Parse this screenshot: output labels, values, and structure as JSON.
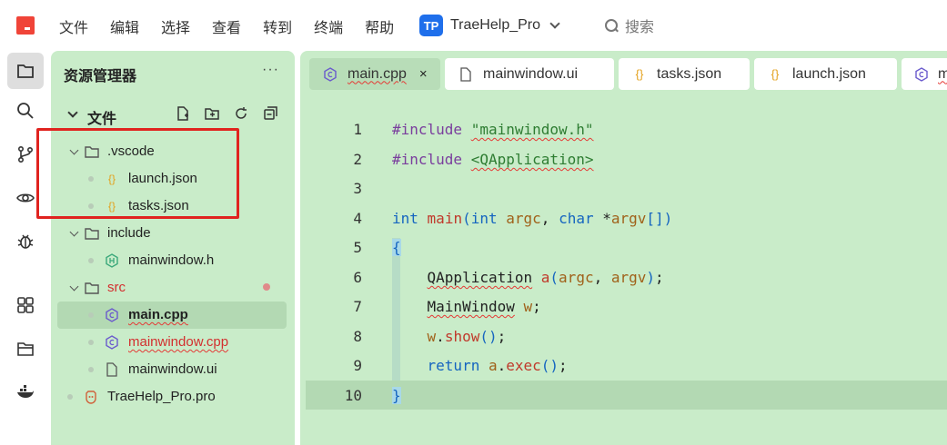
{
  "menu": [
    "文件",
    "编辑",
    "选择",
    "查看",
    "转到",
    "终端",
    "帮助"
  ],
  "project": {
    "badge": "TP",
    "name": "TraeHelp_Pro"
  },
  "search": {
    "label": "搜索"
  },
  "explorer": {
    "title": "资源管理器",
    "more": "···",
    "section_title": "文件",
    "tree": [
      {
        "label": ".vscode",
        "type": "folder",
        "depth": 0,
        "expanded": true
      },
      {
        "label": "launch.json",
        "type": "json",
        "depth": 1
      },
      {
        "label": "tasks.json",
        "type": "json",
        "depth": 1
      },
      {
        "label": "include",
        "type": "folder",
        "depth": 0,
        "expanded": true
      },
      {
        "label": "mainwindow.h",
        "type": "header",
        "depth": 1
      },
      {
        "label": "src",
        "type": "folder",
        "depth": 0,
        "expanded": true,
        "modified": true
      },
      {
        "label": "main.cpp",
        "type": "cpp",
        "depth": 1,
        "selected": true
      },
      {
        "label": "mainwindow.cpp",
        "type": "cpp",
        "depth": 1,
        "error": true
      },
      {
        "label": "mainwindow.ui",
        "type": "ui",
        "depth": 1
      },
      {
        "label": "TraeHelp_Pro.pro",
        "type": "pro",
        "depth": 0
      }
    ]
  },
  "tabs": [
    {
      "label": "main.cpp",
      "icon": "cpp",
      "active": true,
      "close": "×"
    },
    {
      "label": "mainwindow.ui",
      "icon": "file"
    },
    {
      "label": "tasks.json",
      "icon": "json"
    },
    {
      "label": "launch.json",
      "icon": "json"
    },
    {
      "label": "m",
      "icon": "cpp"
    }
  ],
  "code": {
    "line_numbers": [
      "1",
      "2",
      "3",
      "4",
      "5",
      "6",
      "7",
      "8",
      "9",
      "10"
    ],
    "lines": [
      "#include \"mainwindow.h\"",
      "#include <QApplication>",
      "",
      "int main(int argc, char *argv[])",
      "{",
      "    QApplication a(argc, argv);",
      "    MainWindow w;",
      "    w.show();",
      "    return a.exec();",
      "}"
    ],
    "current_line": 10
  },
  "colors": {
    "panel_bg": "#c9ecc9",
    "selected_bg": "#b3d9b3",
    "highlight_box": "#e0231f",
    "brand": "#1f6feb",
    "logo": "#f04438"
  }
}
